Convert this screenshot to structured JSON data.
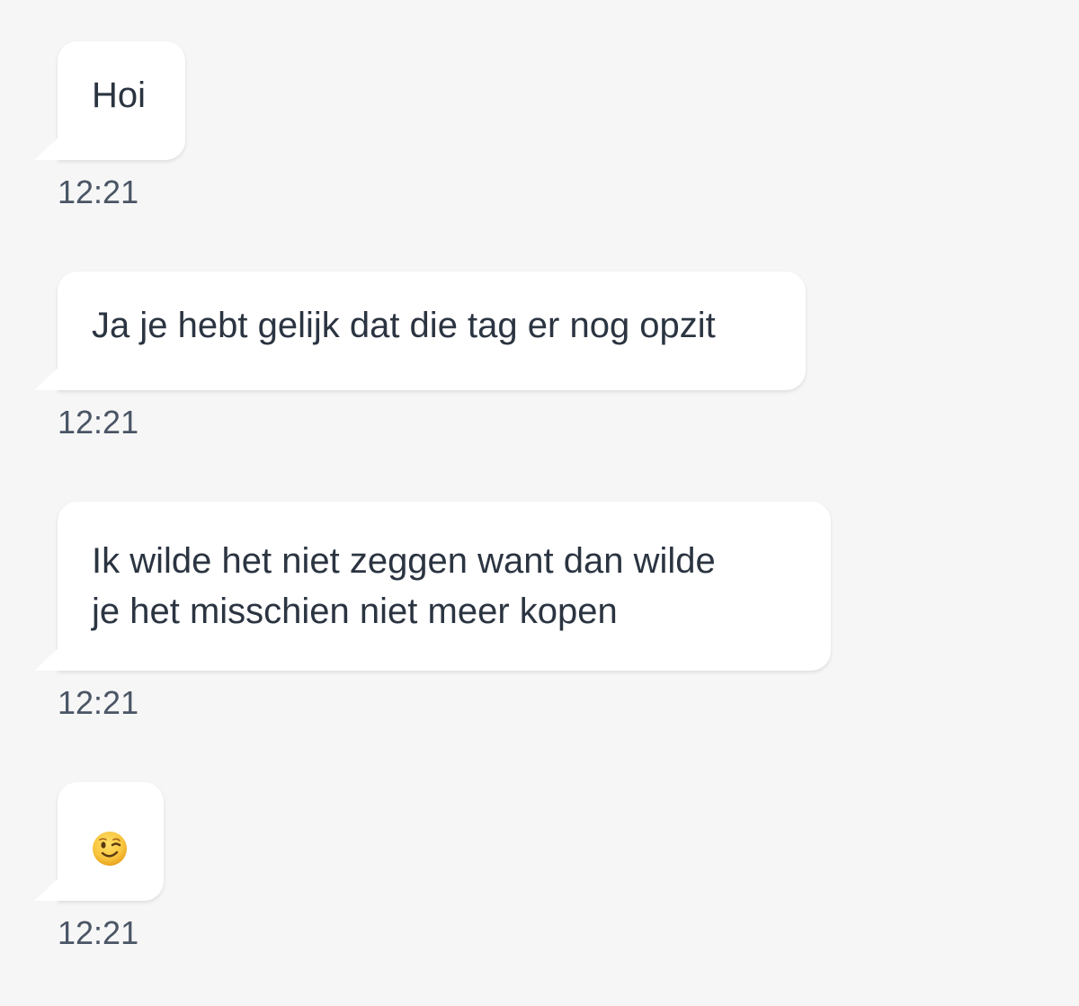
{
  "messages": [
    {
      "text": "Hoi",
      "time": "12:21"
    },
    {
      "text": "Ja je hebt gelijk dat die tag er nog opzit",
      "time": "12:21"
    },
    {
      "text": "Ik wilde het niet zeggen want dan wilde\nje het misschien niet meer kopen",
      "line1": "Ik wilde het niet zeggen want dan wilde",
      "line2": "je het misschien niet meer kopen",
      "time": "12:21"
    },
    {
      "text": "😉",
      "emoji": "winking-face-emoji",
      "time": "12:21"
    }
  ],
  "colors": {
    "background": "#f6f6f6",
    "bubble": "#ffffff",
    "text": "#2b3441",
    "timestamp": "#4a5565",
    "emoji_face": "#f7c33c"
  }
}
